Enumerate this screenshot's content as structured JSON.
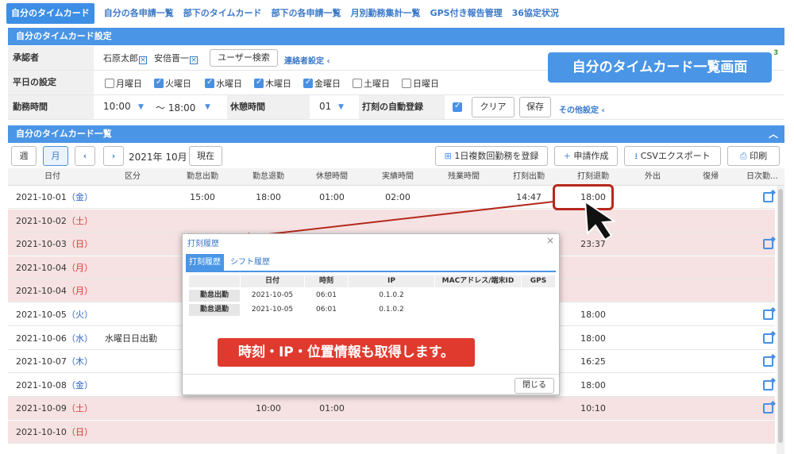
{
  "tabs": [
    {
      "label": "自分のタイムカード",
      "active": true
    },
    {
      "label": "自分の各申請一覧"
    },
    {
      "label": "部下のタイムカード"
    },
    {
      "label": "部下の各申請一覧"
    },
    {
      "label": "月別勤務集計一覧"
    },
    {
      "label": "GPS付き報告管理"
    },
    {
      "label": "36協定状況"
    }
  ],
  "settings": {
    "header": "自分のタイムカード設定",
    "approver_label": "承認者",
    "approvers": [
      "石原太郎",
      "安倍晋一"
    ],
    "user_search": "ユーザー検索",
    "contact_settings": "連絡者設定",
    "weekday_label": "平日の設定",
    "weekdays": [
      {
        "label": "月曜日",
        "checked": false
      },
      {
        "label": "火曜日",
        "checked": true
      },
      {
        "label": "水曜日",
        "checked": true
      },
      {
        "label": "木曜日",
        "checked": true
      },
      {
        "label": "金曜日",
        "checked": true
      },
      {
        "label": "土曜日",
        "checked": false
      },
      {
        "label": "日曜日",
        "checked": false
      }
    ],
    "work_time_label": "勤務時間",
    "work_start": "10:00",
    "work_end": "〜 18:00",
    "break_label": "休憩時間",
    "break_value": "01",
    "auto_stamp_label": "打刻の自動登録",
    "clear": "クリア",
    "save": "保存",
    "other_settings": "その他設定",
    "corner_number": "3"
  },
  "callout_blue": "自分のタイムカード一覧画面",
  "list": {
    "header": "自分のタイムカード一覧",
    "week": "週",
    "month": "月",
    "prev": "‹",
    "next": "›",
    "period": "2021年 10月",
    "current": "現在",
    "multi_register": "1日複数回勤務を登録",
    "apply": "申請作成",
    "csv": "CSVエクスポート",
    "print": "印刷"
  },
  "columns": [
    "日付",
    "区分",
    "勤怠出勤",
    "勤怠退勤",
    "休憩時間",
    "実績時間",
    "残業時間",
    "打刻出勤",
    "打刻退勤",
    "外出",
    "復帰",
    "日次勤…"
  ],
  "rows": [
    {
      "date": "2021-10-01",
      "dow": "金",
      "kind": "",
      "in": "15:00",
      "out": "18:00",
      "break": "01:00",
      "actual": "02:00",
      "stamp_in": "14:47",
      "stamp_out": "18:00",
      "weekend": false
    },
    {
      "date": "2021-10-02",
      "dow": "土",
      "kind": "",
      "in": "",
      "out": "",
      "break": "",
      "actual": "",
      "stamp_in": "",
      "stamp_out": "",
      "weekend": true
    },
    {
      "date": "2021-10-03",
      "dow": "日",
      "kind": "",
      "in": "",
      "out": "",
      "break": "",
      "actual": "",
      "stamp_in": "",
      "stamp_out": "23:37",
      "weekend": true
    },
    {
      "date": "2021-10-04",
      "dow": "月",
      "kind": "",
      "in": "",
      "out": "",
      "break": "",
      "actual": "",
      "stamp_in": "",
      "stamp_out": "",
      "weekend": true
    },
    {
      "date": "2021-10-04",
      "dow": "月",
      "kind": "",
      "in": "",
      "out": "",
      "break": "",
      "actual": "",
      "stamp_in": "",
      "stamp_out": "",
      "weekend": true
    },
    {
      "date": "2021-10-05",
      "dow": "火",
      "kind": "",
      "in": "",
      "out": "",
      "break": "",
      "actual": "",
      "stamp_in": "",
      "stamp_out": "18:00",
      "weekend": false
    },
    {
      "date": "2021-10-06",
      "dow": "水",
      "kind": "水曜日日出勤",
      "in": "",
      "out": "",
      "break": "",
      "actual": "",
      "stamp_in": "",
      "stamp_out": "18:00",
      "weekend": false
    },
    {
      "date": "2021-10-07",
      "dow": "木",
      "kind": "",
      "in": "",
      "out": "",
      "break": "",
      "actual": "",
      "stamp_in": "",
      "stamp_out": "16:25",
      "weekend": false
    },
    {
      "date": "2021-10-08",
      "dow": "金",
      "kind": "",
      "in": "",
      "out": "",
      "break": "",
      "actual": "",
      "stamp_in": "",
      "stamp_out": "18:00",
      "weekend": false
    },
    {
      "date": "2021-10-09",
      "dow": "土",
      "kind": "",
      "in": "",
      "out": "10:00",
      "break": "01:00",
      "actual": "",
      "stamp_in": "",
      "stamp_out": "10:10",
      "weekend": true
    },
    {
      "date": "2021-10-10",
      "dow": "日",
      "kind": "",
      "in": "",
      "out": "",
      "break": "",
      "actual": "",
      "stamp_in": "",
      "stamp_out": "",
      "weekend": true
    }
  ],
  "modal": {
    "title": "打刻履歴",
    "tab_stamp": "打刻履歴",
    "tab_shift": "シフト履歴",
    "columns": [
      "日付",
      "時刻",
      "IP",
      "MACアドレス/端末ID",
      "GPS"
    ],
    "rows": [
      {
        "label": "勤怠出勤",
        "date": "2021-10-05",
        "time": "06:01",
        "ip": "0.1.0.2"
      },
      {
        "label": "勤怠退勤",
        "date": "2021-10-05",
        "time": "06:01",
        "ip": "0.1.0.2"
      }
    ],
    "close": "閉じる"
  },
  "callout_red": "時刻・IP・位置情報も取得します。",
  "colors": {
    "accent": "#4a95e6",
    "weekend_row": "#f6e2e2",
    "callout_red": "#e03a2e",
    "highlight": "#b5291d"
  }
}
